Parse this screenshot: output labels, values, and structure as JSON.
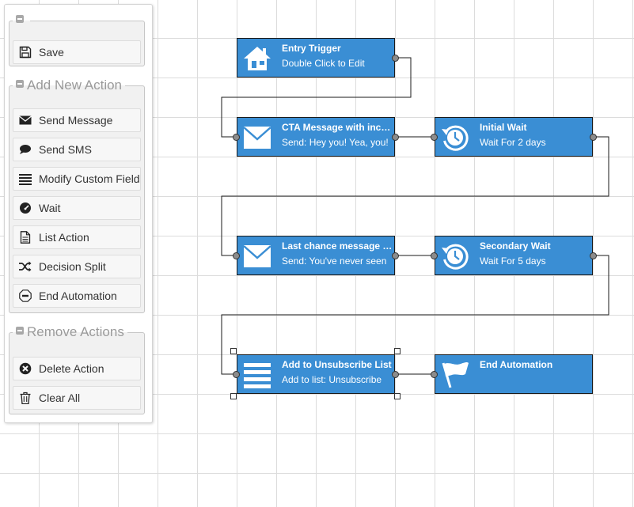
{
  "panel": {
    "top_button": {
      "label": "Save",
      "icon": "floppy-disk-icon"
    },
    "add_group": {
      "legend": "Add New Action",
      "items": [
        {
          "label": "Send Message",
          "icon": "envelope-icon"
        },
        {
          "label": "Send SMS",
          "icon": "speech-bubble-icon"
        },
        {
          "label": "Modify Custom Field",
          "icon": "lines-icon"
        },
        {
          "label": "Wait",
          "icon": "gauge-icon"
        },
        {
          "label": "List Action",
          "icon": "document-icon"
        },
        {
          "label": "Decision Split",
          "icon": "shuffle-icon"
        },
        {
          "label": "End Automation",
          "icon": "stop-sign-icon"
        }
      ]
    },
    "remove_group": {
      "legend": "Remove Actions",
      "items": [
        {
          "label": "Delete Action",
          "icon": "x-circle-icon"
        },
        {
          "label": "Clear All",
          "icon": "trash-icon"
        }
      ]
    }
  },
  "flow": {
    "nodes": [
      {
        "title": "Entry Trigger",
        "subtitle": "Double Click to Edit",
        "icon": "house-icon"
      },
      {
        "title": "CTA Message with incentive",
        "subtitle": "Send: Hey you! Yea, you!",
        "icon": "envelope-icon"
      },
      {
        "title": "Initial Wait",
        "subtitle": "Wait For 2 days",
        "icon": "clock-icon"
      },
      {
        "title": "Last chance message with",
        "subtitle": "Send: You've never seen",
        "icon": "envelope-icon"
      },
      {
        "title": "Secondary Wait",
        "subtitle": "Wait For 5 days",
        "icon": "clock-icon"
      },
      {
        "title": "Add to Unsubscribe List",
        "subtitle": "Add to list: Unsubscribe",
        "icon": "list-icon"
      },
      {
        "title": "End Automation",
        "subtitle": "",
        "icon": "flag-icon"
      }
    ]
  },
  "colors": {
    "node_fill": "#3a8ed4",
    "node_border": "#1a1a1a",
    "grid_line": "#dcdcdc",
    "panel_group_bg": "#f1f1f1"
  }
}
